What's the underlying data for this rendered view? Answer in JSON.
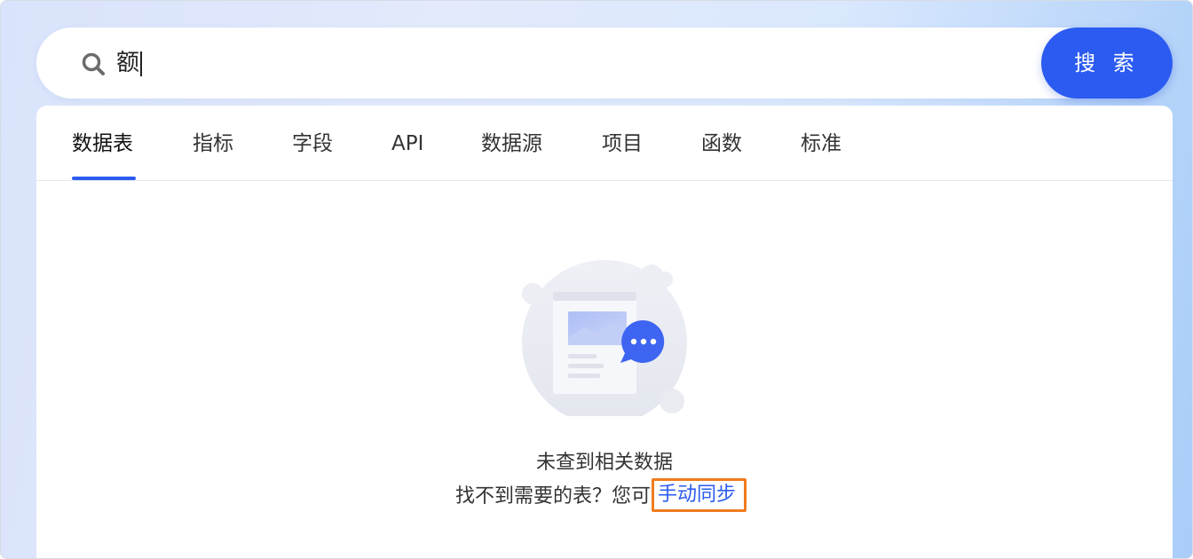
{
  "search": {
    "query": "额",
    "button_label": "搜 索"
  },
  "tabs": [
    {
      "label": "数据表",
      "active": true
    },
    {
      "label": "指标"
    },
    {
      "label": "字段"
    },
    {
      "label": "API"
    },
    {
      "label": "数据源"
    },
    {
      "label": "项目"
    },
    {
      "label": "函数"
    },
    {
      "label": "标准"
    }
  ],
  "empty_state": {
    "title": "未查到相关数据",
    "hint_prefix": "找不到需要的表？您可",
    "action_link": "手动同步"
  },
  "colors": {
    "accent": "#2b5bf0",
    "highlight_border": "#f07b1e"
  }
}
